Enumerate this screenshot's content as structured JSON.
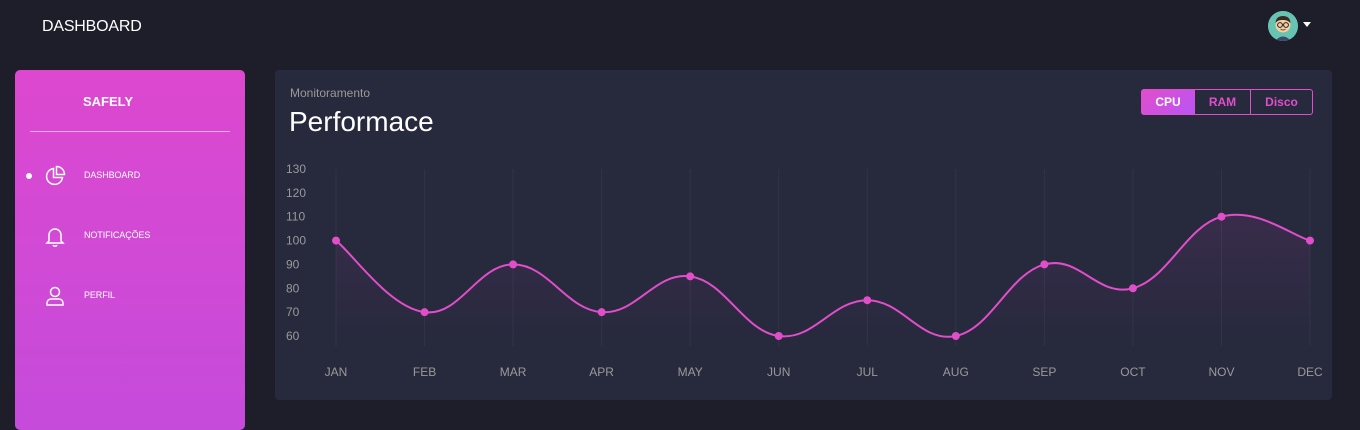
{
  "header": {
    "brand": "DASHBOARD",
    "avatar_icon": "avatar-cartoon-icon",
    "dropdown_icon": "caret-down-icon"
  },
  "sidebar": {
    "logo": "SAFELY",
    "items": [
      {
        "label": "DASHBOARD",
        "icon": "pie-chart-icon",
        "active": true
      },
      {
        "label": "NOTIFICAÇÕES",
        "icon": "bell-icon",
        "active": false
      },
      {
        "label": "PERFIL",
        "icon": "user-icon",
        "active": false
      }
    ]
  },
  "card": {
    "subtitle": "Monitoramento",
    "title": "Performace",
    "toggle": [
      {
        "label": "CPU",
        "active": true
      },
      {
        "label": "RAM",
        "active": false
      },
      {
        "label": "Disco",
        "active": false
      }
    ]
  },
  "colors": {
    "accent": "#e14eca",
    "accent2": "#ba54f5",
    "background": "#1e1e2b",
    "card": "#27293d",
    "text_muted": "#9a9a9a"
  },
  "chart_data": {
    "type": "line",
    "title": "",
    "xlabel": "",
    "ylabel": "",
    "categories": [
      "JAN",
      "FEB",
      "MAR",
      "APR",
      "MAY",
      "JUN",
      "JUL",
      "AUG",
      "SEP",
      "OCT",
      "NOV",
      "DEC"
    ],
    "series": [
      {
        "values": [
          100,
          70,
          90,
          70,
          85,
          60,
          75,
          60,
          90,
          80,
          110,
          100
        ]
      }
    ],
    "ylim": [
      60,
      130
    ],
    "yticks": [
      60,
      70,
      80,
      90,
      100,
      110,
      120,
      130
    ],
    "grid": "vertical",
    "legend": "none",
    "line_color": "#e14eca"
  }
}
